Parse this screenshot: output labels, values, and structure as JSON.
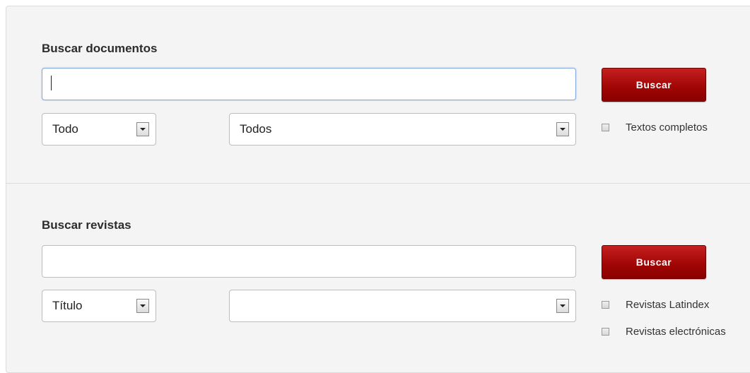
{
  "documents": {
    "title": "Buscar documentos",
    "query_value": "",
    "search_button": "Buscar",
    "field_select": "Todo",
    "scope_select": "Todos",
    "fulltext_label": "Textos completos"
  },
  "journals": {
    "title": "Buscar revistas",
    "query_value": "",
    "search_button": "Buscar",
    "field_select": "Título",
    "scope_select": "",
    "latindex_label": "Revistas Latindex",
    "electronic_label": "Revistas electrónicas"
  }
}
